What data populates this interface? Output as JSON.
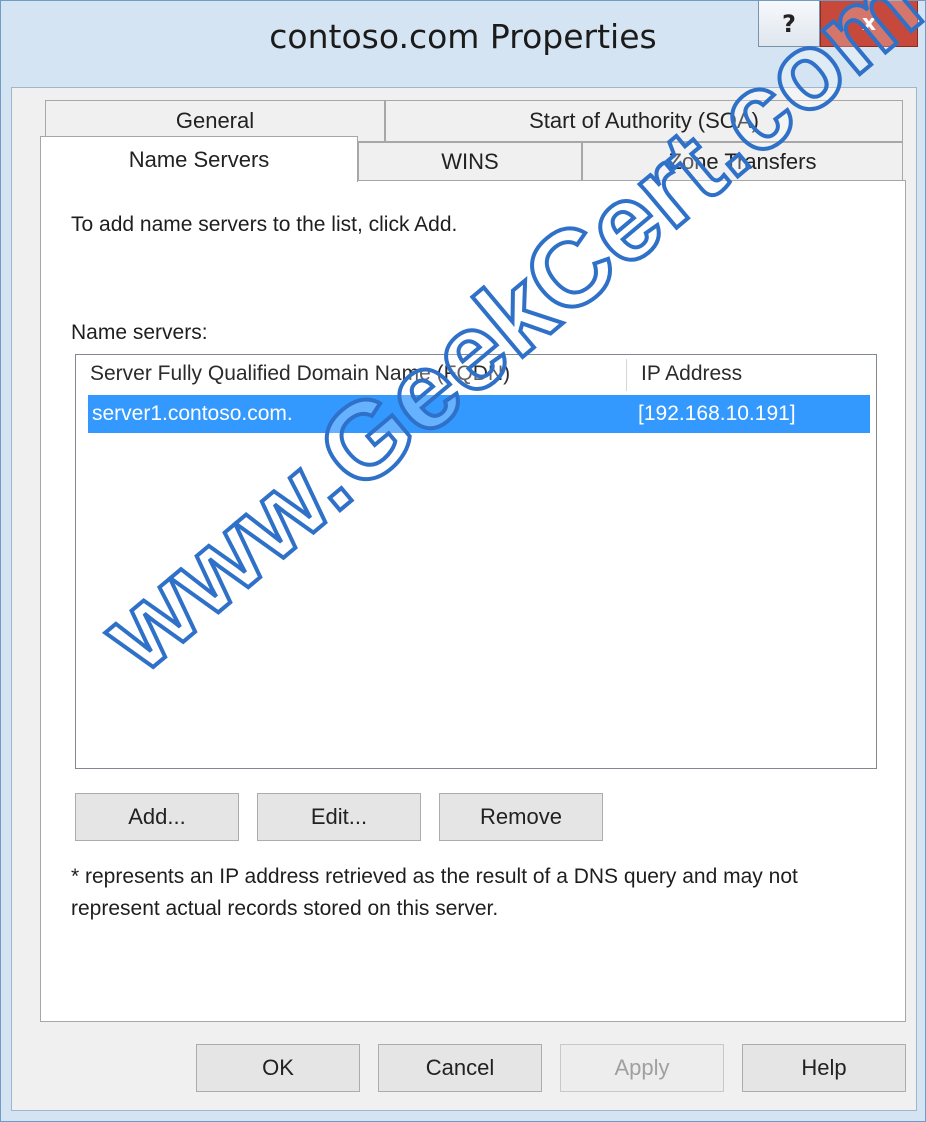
{
  "window": {
    "title": "contoso.com Properties",
    "help_glyph": "?",
    "close_glyph": "x"
  },
  "tabs": {
    "general": "General",
    "soa": "Start of Authority (SOA)",
    "name_servers": "Name Servers",
    "wins": "WINS",
    "zone_transfers": "Zone Transfers",
    "active": "Name Servers"
  },
  "panel": {
    "instruction": "To add name servers to the list, click Add.",
    "list_label": "Name servers:",
    "columns": [
      "Server Fully Qualified Domain Name (FQDN)",
      "IP Address"
    ],
    "rows": [
      {
        "fqdn": "server1.contoso.com.",
        "ip": "[192.168.10.191]",
        "selected": true
      }
    ],
    "buttons": {
      "add": "Add...",
      "edit": "Edit...",
      "remove": "Remove"
    },
    "note": "* represents an IP address retrieved as the result of a DNS query and may not represent actual records stored on this server."
  },
  "footer": {
    "ok": "OK",
    "cancel": "Cancel",
    "apply": "Apply",
    "apply_enabled": false,
    "help": "Help"
  },
  "watermark": "www.GeekCert.com",
  "colors": {
    "selection": "#3399ff",
    "window_frame": "#d4e4f2",
    "close_button": "#c7493b",
    "watermark_stroke": "#2f71c8"
  }
}
